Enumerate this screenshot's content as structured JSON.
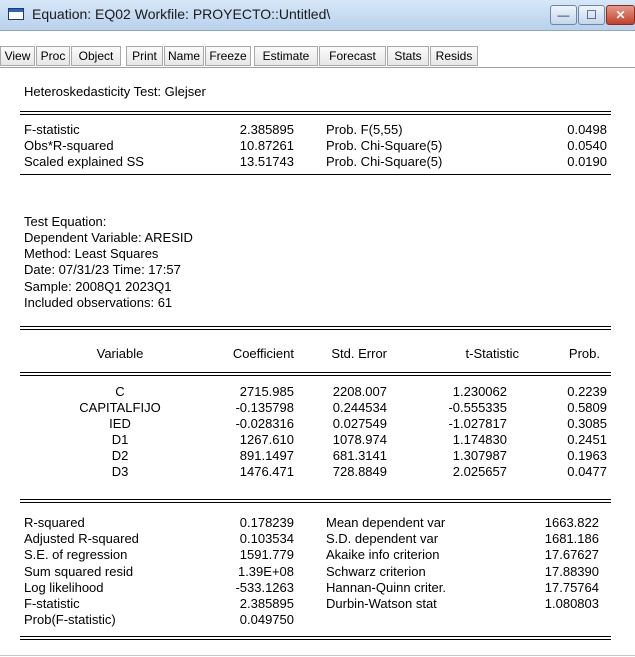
{
  "window": {
    "title": "Equation: EQ02   Workfile: PROYECTO::Untitled\\",
    "min_glyph": "—",
    "max_glyph": "☐",
    "close_glyph": "✕"
  },
  "toolbar": [
    "View",
    "Proc",
    "Object",
    "Print",
    "Name",
    "Freeze",
    "Estimate",
    "Forecast",
    "Stats",
    "Resids"
  ],
  "test_name": "Heteroskedasticity Test: Glejser",
  "summary_stats": [
    {
      "label": "F-statistic",
      "value": "2.385895",
      "prob_label": "Prob. F(5,55)",
      "prob": "0.0498"
    },
    {
      "label": "Obs*R-squared",
      "value": "10.87261",
      "prob_label": "Prob. Chi-Square(5)",
      "prob": "0.0540"
    },
    {
      "label": "Scaled explained SS",
      "value": "13.51743",
      "prob_label": "Prob. Chi-Square(5)",
      "prob": "0.0190"
    }
  ],
  "test_equation": {
    "lines": [
      "Test Equation:",
      "Dependent Variable: ARESID",
      "Method: Least Squares",
      "Date: 07/31/23   Time: 17:57",
      "Sample: 2008Q1 2023Q1",
      "Included observations: 61"
    ]
  },
  "coef_table": {
    "headers": [
      "Variable",
      "Coefficient",
      "Std. Error",
      "t-Statistic",
      "Prob."
    ],
    "rows": [
      [
        "C",
        "2715.985",
        "2208.007",
        "1.230062",
        "0.2239"
      ],
      [
        "CAPITALFIJO",
        "-0.135798",
        "0.244534",
        "-0.555335",
        "0.5809"
      ],
      [
        "IED",
        "-0.028316",
        "0.027549",
        "-1.027817",
        "0.3085"
      ],
      [
        "D1",
        "1267.610",
        "1078.974",
        "1.174830",
        "0.2451"
      ],
      [
        "D2",
        "891.1497",
        "681.3141",
        "1.307987",
        "0.1963"
      ],
      [
        "D3",
        "1476.471",
        "728.8849",
        "2.025657",
        "0.0477"
      ]
    ]
  },
  "regression_stats": [
    [
      "R-squared",
      "0.178239",
      "Mean dependent var",
      "1663.822"
    ],
    [
      "Adjusted R-squared",
      "0.103534",
      "S.D. dependent var",
      "1681.186"
    ],
    [
      "S.E. of regression",
      "1591.779",
      "Akaike info criterion",
      "17.67627"
    ],
    [
      "Sum squared resid",
      "1.39E+08",
      "Schwarz criterion",
      "17.88390"
    ],
    [
      "Log likelihood",
      "-533.1263",
      "Hannan-Quinn criter.",
      "17.75764"
    ],
    [
      "F-statistic",
      "2.385895",
      "Durbin-Watson stat",
      "1.080803"
    ],
    [
      "Prob(F-statistic)",
      "0.049750",
      "",
      ""
    ]
  ]
}
